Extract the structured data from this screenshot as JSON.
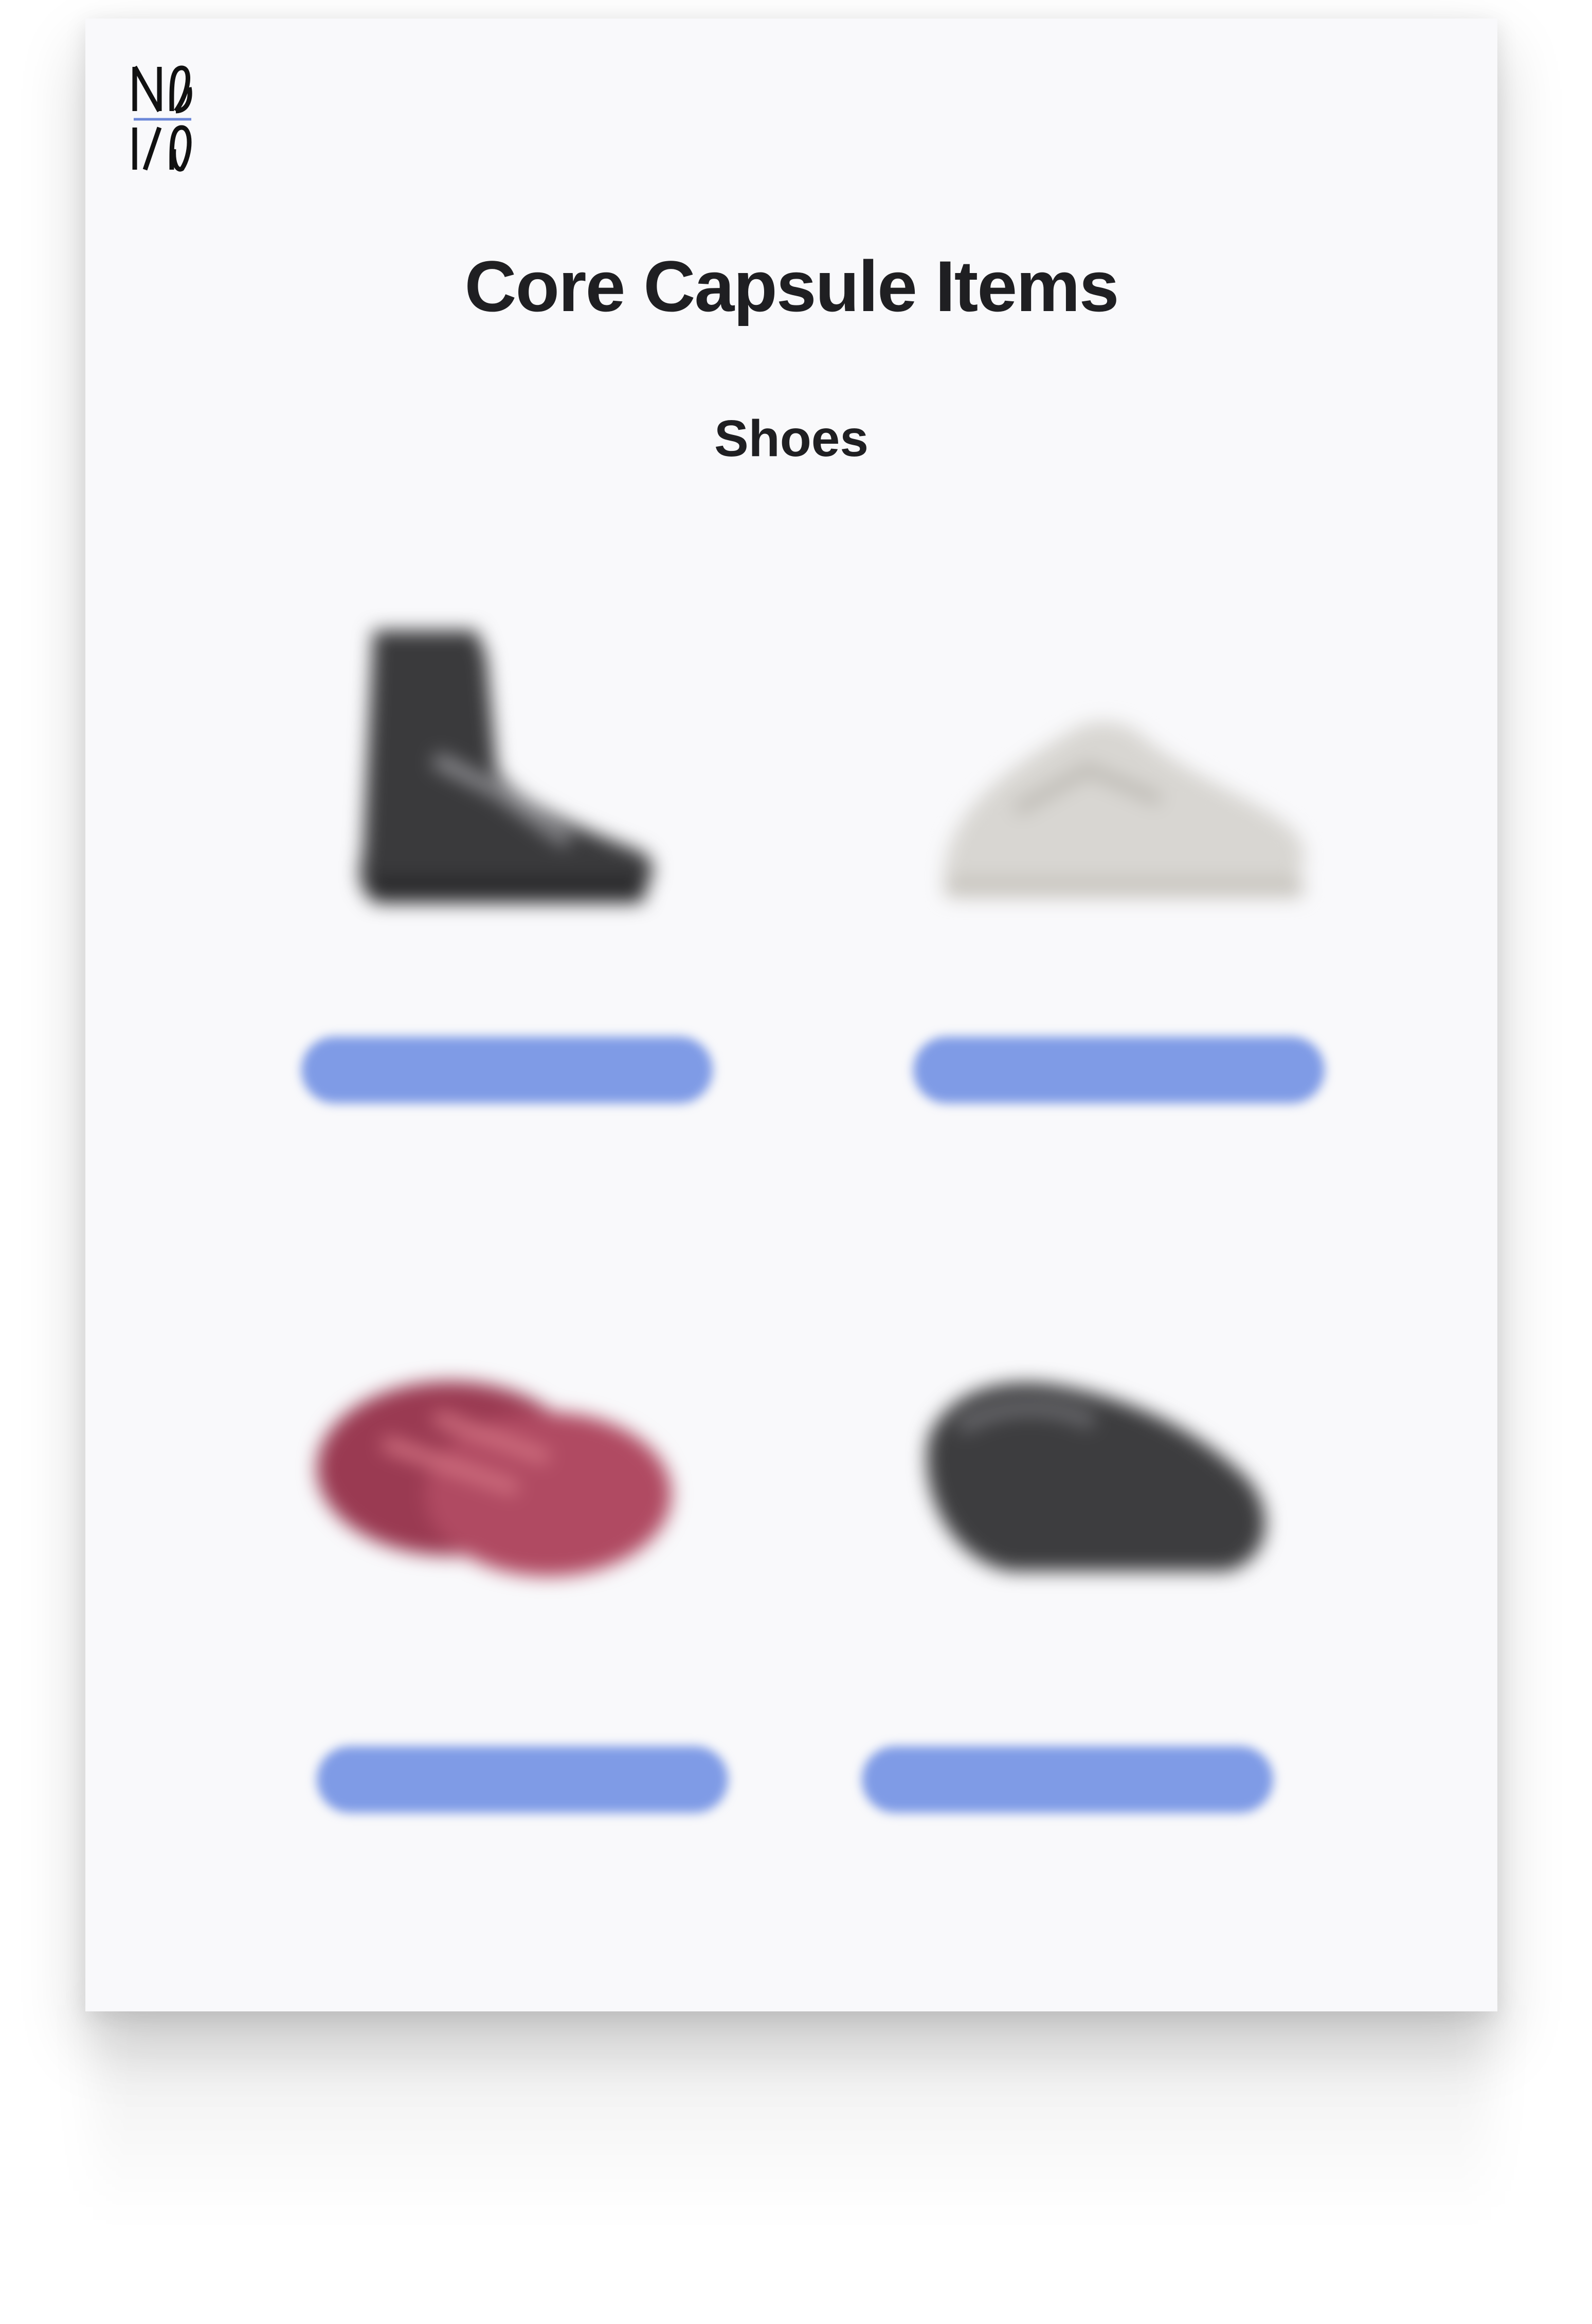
{
  "document": {
    "title": "Core Capsule Items",
    "section": "Shoes",
    "logo_letters": "NONO"
  },
  "products": [
    {
      "icon": "ankle-boot-image",
      "name": "",
      "button_label": "",
      "color": "#3a3a3c"
    },
    {
      "icon": "sneaker-image",
      "name": "",
      "button_label": "",
      "color": "#d8d6d2"
    },
    {
      "icon": "sandal-image",
      "name": "",
      "button_label": "",
      "color": "#9a3a52"
    },
    {
      "icon": "clog-image",
      "name": "",
      "button_label": "",
      "color": "#3d3d3f"
    }
  ],
  "footer": {
    "note": ""
  },
  "colors": {
    "accent": "#7f9be6",
    "page_background": "#f9f9fb",
    "text": "#1f1f22"
  }
}
